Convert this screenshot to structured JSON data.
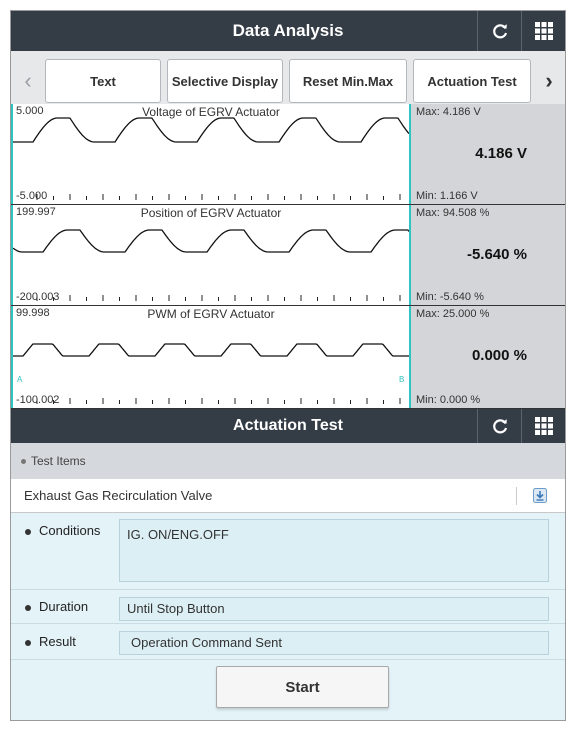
{
  "header": {
    "title": "Data Analysis",
    "refresh_icon": "refresh-icon",
    "grid_icon": "grid-menu-icon"
  },
  "tabs": {
    "prev_icon": "chevron-left-icon",
    "next_icon": "chevron-right-icon",
    "items": [
      {
        "label": "Text"
      },
      {
        "label": "Selective Display"
      },
      {
        "label": "Reset Min.Max"
      },
      {
        "label": "Actuation Test"
      }
    ]
  },
  "graphs": [
    {
      "name": "Voltage of EGRV Actuator",
      "top_label": "5.000",
      "bottom_label": "-5.000",
      "max": "Max: 4.186 V",
      "current": "4.186 V",
      "min": "Min: 1.166 V"
    },
    {
      "name": "Position of EGRV Actuator",
      "top_label": "199.997",
      "bottom_label": "-200.003",
      "max": "Max: 94.508 %",
      "current": "-5.640 %",
      "min": "Min: -5.640 %"
    },
    {
      "name": "PWM of EGRV Actuator",
      "top_label": "99.998",
      "bottom_label": "-100.002",
      "max": "Max: 25.000 %",
      "current": "0.000 %",
      "min": "Min: 0.000 %",
      "marker_a": "A",
      "marker_b": "B"
    }
  ],
  "actuation": {
    "title": "Actuation Test",
    "section_label": "Test Items",
    "item": "Exhaust Gas Recirculation Valve",
    "download_icon": "download-icon",
    "conditions_label": "Conditions",
    "conditions_value": "IG. ON/ENG.OFF",
    "duration_label": "Duration",
    "duration_value": "Until Stop Button",
    "result_label": "Result",
    "result_value": "Operation Command Sent",
    "start_label": "Start"
  },
  "colors": {
    "header_bg": "#343c46",
    "cursor_line": "#2ec4c4",
    "detail_bg": "#e4f3f8",
    "side_panel": "#d3d5d8"
  }
}
